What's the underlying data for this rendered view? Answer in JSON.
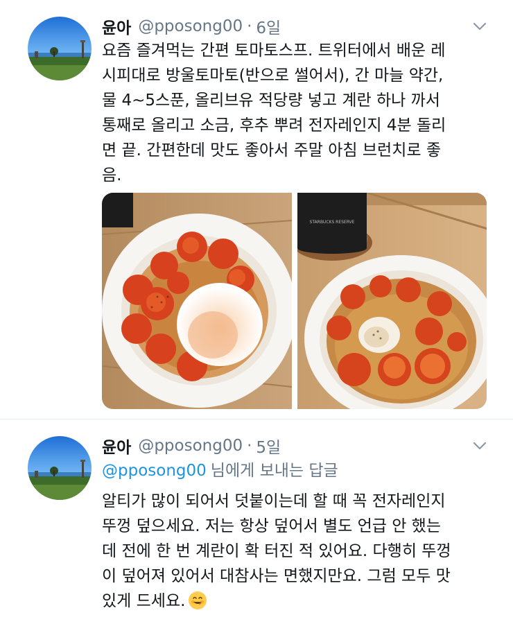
{
  "tweets": [
    {
      "name": "윤아",
      "handle": "@pposong00",
      "separator": "·",
      "time": "6일",
      "lines": [
        "요즘 즐겨먹는 간편 토마토스프. 트위터에서 배운 레",
        "시피대로 방울토마토(반으로 썰어서), 간 마늘 약간,",
        "물 4~5스푼, 올리브유 적당량 넣고 계란 하나 까서",
        "통째로 올리고 소금, 후추 뿌려 전자레인지 4분 돌리",
        "면 끝. 간편한데 맛도 좋아서 주말 아침 브런치로 좋",
        "음."
      ],
      "photos": [
        {
          "icon": "tomato-egg-bowl-photo"
        },
        {
          "icon": "tomato-soup-bowl-photo",
          "cup_text": "STARBUCKS RESERVE"
        }
      ]
    },
    {
      "name": "윤아",
      "handle": "@pposong00",
      "separator": "·",
      "time": "5일",
      "replying_to": "@pposong00",
      "replying_suffix": "님에게 보내는 답글",
      "lines": [
        "알티가 많이 되어서 덧붙이는데 할 때 꼭 전자레인지",
        "뚜껑 덮으세요. 저는 항상 덮어서 별도 언급 안 했는",
        "데 전에 한 번 계란이 확 터진 적 있어요. 다행히 뚜껑",
        "이 덮어져 있어서 대참사는 면했지만요. 그럼 모두 맛",
        "있게 드세요."
      ],
      "emoji": "yum-face-emoji"
    }
  ],
  "colors": {
    "text": "#14171a",
    "secondary": "#657786",
    "link": "#1b95e0",
    "divider": "#e6ecf0"
  }
}
